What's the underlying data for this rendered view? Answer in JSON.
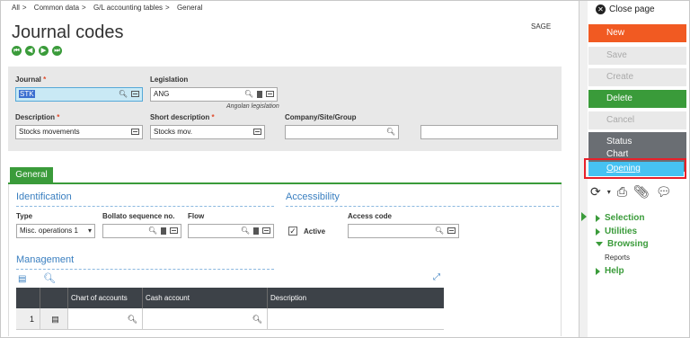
{
  "breadcrumb": [
    "All",
    "Common data",
    "G/L accounting tables",
    "General"
  ],
  "breadcrumb_sep": ">",
  "title": "Journal codes",
  "sage_label": "SAGE",
  "nav_icons": [
    "first-record-icon",
    "previous-record-icon",
    "next-record-icon",
    "last-record-icon"
  ],
  "header": {
    "journal_label": "Journal",
    "journal_value": "STK",
    "legislation_label": "Legislation",
    "legislation_value": "ANG",
    "legislation_hint": "Angolan legislation",
    "description_label": "Description",
    "description_value": "Stocks movements",
    "short_description_label": "Short description",
    "short_description_value": "Stocks mov.",
    "company_label": "Company/Site/Group",
    "company_value": "",
    "extra_value": "",
    "required_mark": "*"
  },
  "tab": {
    "label": "General"
  },
  "identification": {
    "title": "Identification",
    "type_label": "Type",
    "type_value": "Misc. operations 1",
    "bollato_label": "Bollato sequence no.",
    "bollato_value": "",
    "flow_label": "Flow",
    "flow_value": ""
  },
  "accessibility": {
    "title": "Accessibility",
    "active_label": "Active",
    "active_checked": true,
    "access_code_label": "Access code",
    "access_code_value": ""
  },
  "management": {
    "title": "Management",
    "columns": [
      "Chart of accounts",
      "Cash account",
      "Description"
    ],
    "rows": [
      {
        "num": "1",
        "chart_of_accounts": "",
        "cash_account": "",
        "description": ""
      }
    ]
  },
  "sidebar": {
    "close_label": "Close page",
    "new_label": "New",
    "save_label": "Save",
    "create_label": "Create",
    "delete_label": "Delete",
    "cancel_label": "Cancel",
    "status_label": "Status",
    "chart_label": "Chart",
    "opening_label": "Opening",
    "menus": [
      "Selection",
      "Utilities",
      "Browsing",
      "Help"
    ],
    "reports_label": "Reports"
  },
  "colors": {
    "accent_green": "#3a9b3a",
    "new_orange": "#f15a22",
    "opening_blue": "#46c2f2",
    "highlight_red": "#e8202a",
    "section_blue": "#3a7fc0"
  }
}
